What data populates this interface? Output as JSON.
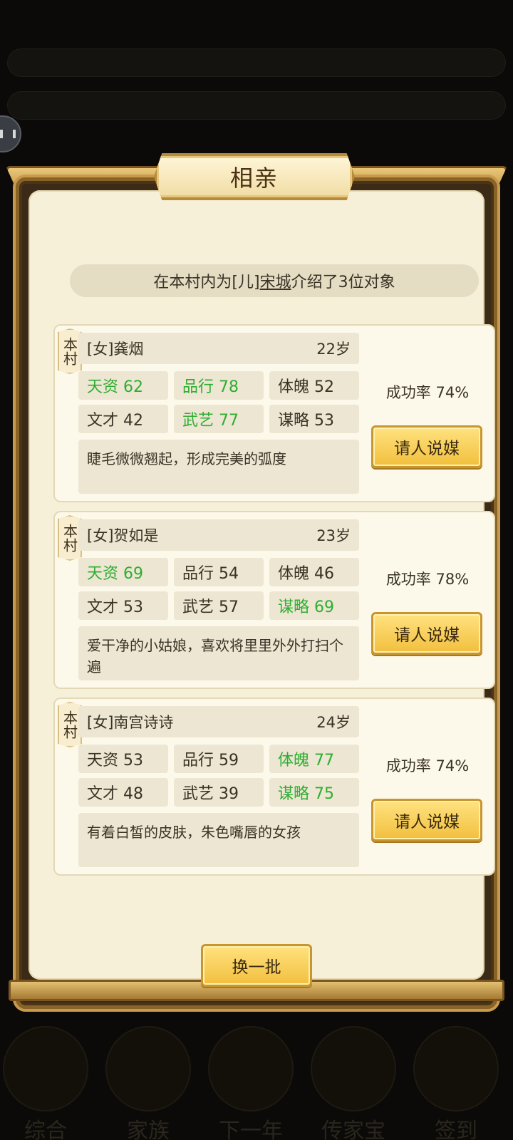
{
  "dialog": {
    "title": "相亲",
    "info": {
      "prefix": "在本村内为[儿]",
      "name": "宋城",
      "suffix": "介绍了3位对象"
    },
    "batch_button": "换一批"
  },
  "candidates": [
    {
      "tag": "本村",
      "name": "[女]龚烟",
      "age": "22岁",
      "stats": [
        {
          "label": "天资 62",
          "highlight": true
        },
        {
          "label": "品行 78",
          "highlight": true
        },
        {
          "label": "体魄 52",
          "highlight": false
        },
        {
          "label": "文才 42",
          "highlight": false
        },
        {
          "label": "武艺 77",
          "highlight": true
        },
        {
          "label": "谋略 53",
          "highlight": false
        }
      ],
      "description": "睫毛微微翘起，形成完美的弧度",
      "success_rate": "成功率 74%",
      "button": "请人说媒"
    },
    {
      "tag": "本村",
      "name": "[女]贺如是",
      "age": "23岁",
      "stats": [
        {
          "label": "天资 69",
          "highlight": true
        },
        {
          "label": "品行 54",
          "highlight": false
        },
        {
          "label": "体魄 46",
          "highlight": false
        },
        {
          "label": "文才 53",
          "highlight": false
        },
        {
          "label": "武艺 57",
          "highlight": false
        },
        {
          "label": "谋略 69",
          "highlight": true
        }
      ],
      "description": "爱干净的小姑娘，喜欢将里里外外打扫个遍",
      "success_rate": "成功率 78%",
      "button": "请人说媒"
    },
    {
      "tag": "本村",
      "name": "[女]南宫诗诗",
      "age": "24岁",
      "stats": [
        {
          "label": "天资 53",
          "highlight": false
        },
        {
          "label": "品行 59",
          "highlight": false
        },
        {
          "label": "体魄 77",
          "highlight": true
        },
        {
          "label": "文才 48",
          "highlight": false
        },
        {
          "label": "武艺 39",
          "highlight": false
        },
        {
          "label": "谋略 75",
          "highlight": true
        }
      ],
      "description": "有着白皙的皮肤，朱色嘴唇的女孩",
      "success_rate": "成功率 74%",
      "button": "请人说媒"
    }
  ],
  "background": {
    "tabs": [
      "综合",
      "家族",
      "下一年",
      "传家宝",
      "签到"
    ]
  },
  "colors": {
    "highlight": "#2fae32",
    "text": "#3a3326",
    "gold": "#f2bf3e"
  }
}
